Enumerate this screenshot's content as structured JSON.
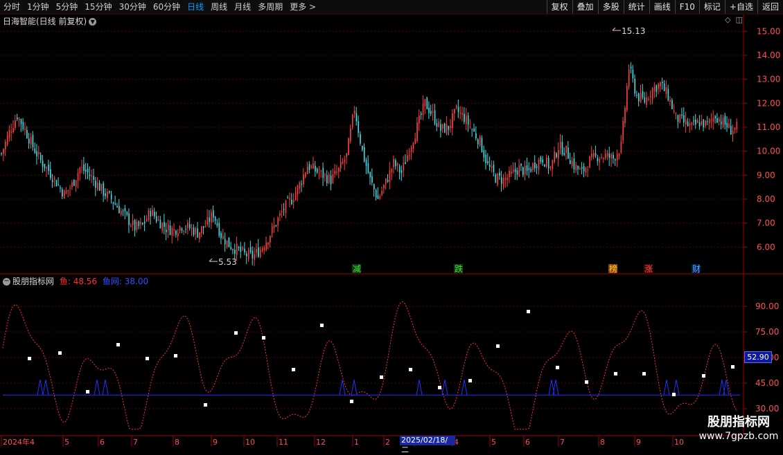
{
  "toolbar": {
    "timeframes": [
      "分时",
      "1分钟",
      "5分钟",
      "15分钟",
      "30分钟",
      "60分钟",
      "日线",
      "周线",
      "月线",
      "多周期",
      "更多"
    ],
    "active": "日线",
    "more_arrow": ">",
    "right_buttons": [
      "复权",
      "叠加",
      "多股",
      "统计",
      "画线",
      "F10",
      "标记",
      "+自选",
      "返回"
    ]
  },
  "main_chart": {
    "title": "日海智能(日线 前复权)",
    "yticks": [
      "15.00",
      "14.00",
      "13.00",
      "12.00",
      "11.00",
      "10.00",
      "9.00",
      "8.00",
      "7.00",
      "6.00"
    ],
    "high_label": "15.13",
    "low_label": "5.53",
    "events": [
      "减",
      "跌",
      "榜",
      "涨",
      "财"
    ]
  },
  "indicator": {
    "name": "股朋指标网",
    "line1_label": "鱼: 48.56",
    "line2_label": "鱼网: 38.00",
    "yticks": [
      "90.00",
      "75.00",
      "60.00",
      "45.00",
      "30.00"
    ],
    "current_value": "52.90"
  },
  "x_axis": {
    "labels": [
      "2024年4",
      "5",
      "6",
      "7",
      "8",
      "9",
      "10",
      "11",
      "12",
      "1",
      "2",
      "3",
      "4",
      "5",
      "6",
      "7",
      "8",
      "9",
      "10"
    ],
    "highlight_date": "2025/02/18/二"
  },
  "watermark": {
    "line1": "股朋指标网",
    "line2": "www.7gpzb.com"
  },
  "colors": {
    "up": "#ff4040",
    "down": "#40e0e8",
    "grid": "#5a0000",
    "axis": "#a00000",
    "fish": "#ff3030",
    "net": "#2030ff"
  },
  "chart_data": {
    "type": "candlestick",
    "price_ylim": [
      5.0,
      15.5
    ],
    "indicator_ylim": [
      15,
      105
    ],
    "fish_net_level": 38.0,
    "close_series": [
      9.9,
      10.8,
      11.5,
      10.9,
      10.2,
      9.6,
      9.2,
      8.7,
      8.2,
      8.6,
      9.3,
      9.1,
      8.7,
      8.3,
      8.0,
      7.6,
      7.2,
      6.8,
      6.9,
      7.5,
      7.1,
      6.8,
      6.7,
      6.9,
      6.8,
      6.6,
      6.9,
      7.4,
      6.5,
      6.1,
      5.9,
      5.7,
      5.6,
      5.9,
      6.4,
      7.0,
      7.6,
      8.0,
      8.6,
      9.4,
      9.2,
      9.0,
      8.8,
      9.2,
      9.8,
      11.8,
      10.0,
      8.8,
      8.0,
      8.7,
      9.5,
      9.1,
      10.1,
      11.0,
      12.0,
      11.5,
      10.9,
      11.0,
      11.7,
      11.4,
      10.9,
      10.4,
      9.4,
      8.9,
      8.8,
      9.0,
      9.3,
      9.1,
      9.5,
      9.7,
      9.3,
      10.2,
      10.0,
      9.4,
      9.1,
      9.6,
      9.8,
      9.8,
      9.7,
      10.2,
      13.5,
      12.3,
      12.1,
      12.6,
      12.8,
      12.3,
      11.4,
      11.2,
      11.0,
      11.2,
      11.1,
      11.5,
      11.2,
      10.9,
      11.0
    ]
  }
}
